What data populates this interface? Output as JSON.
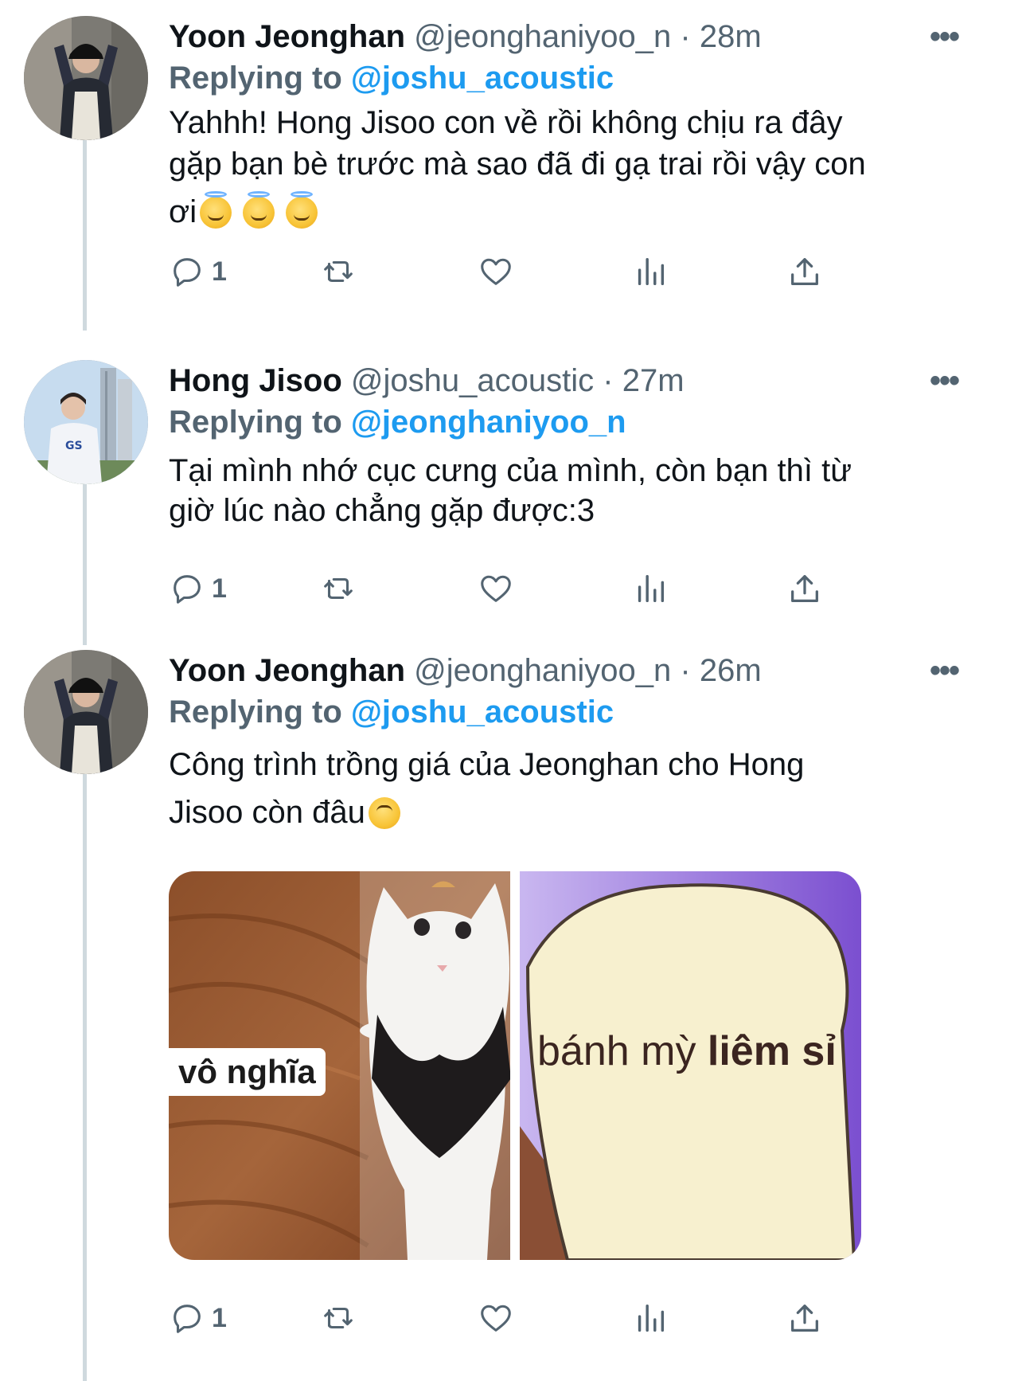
{
  "colors": {
    "link": "#1d9bf0",
    "muted": "#536471",
    "text": "#0f1419",
    "thread_line": "#cfd9de"
  },
  "tweets": [
    {
      "name": "Yoon Jeonghan",
      "handle": "@jeonghaniyoo_n",
      "separator": "·",
      "time": "28m",
      "more": "•••",
      "replying_prefix": "Replying to",
      "replying_handle": "@joshu_acoustic",
      "text_line1": "Yahhh! Hong Jisoo con về rồi không chịu ra đây",
      "text_line2": "gặp bạn bè trước mà sao đã đi gạ trai rồi vậy con",
      "text_line3": "ơi",
      "emojis": [
        "smiling-face-with-halo",
        "smiling-face-with-halo",
        "smiling-face-with-halo"
      ],
      "reply_count": "1"
    },
    {
      "name": "Hong Jisoo",
      "handle": "@joshu_acoustic",
      "separator": "·",
      "time": "27m",
      "more": "•••",
      "replying_prefix": "Replying to",
      "replying_handle": "@jeonghaniyoo_n",
      "text_line1": "Tại mình nhớ cục cưng của mình, còn bạn thì từ",
      "text_line2": "giờ lúc nào chẳng gặp được:3",
      "reply_count": "1"
    },
    {
      "name": "Yoon Jeonghan",
      "handle": "@jeonghaniyoo_n",
      "separator": "·",
      "time": "26m",
      "more": "•••",
      "replying_prefix": "Replying to",
      "replying_handle": "@joshu_acoustic",
      "text_line1": "Công trình trồng giá của Jeonghan cho Hong",
      "text_line2": "Jisoo còn đâu",
      "emojis": [
        "upside-down-face"
      ],
      "reply_count": "1",
      "media": [
        {
          "caption": "vô nghĩa",
          "description": "cat-photo"
        },
        {
          "caption_part1": "bánh mỳ",
          "caption_part2": "liêm sỉ",
          "description": "bread-cartoon"
        }
      ]
    }
  ],
  "action_icons": [
    "reply-icon",
    "retweet-icon",
    "like-icon",
    "analytics-icon",
    "share-icon"
  ]
}
